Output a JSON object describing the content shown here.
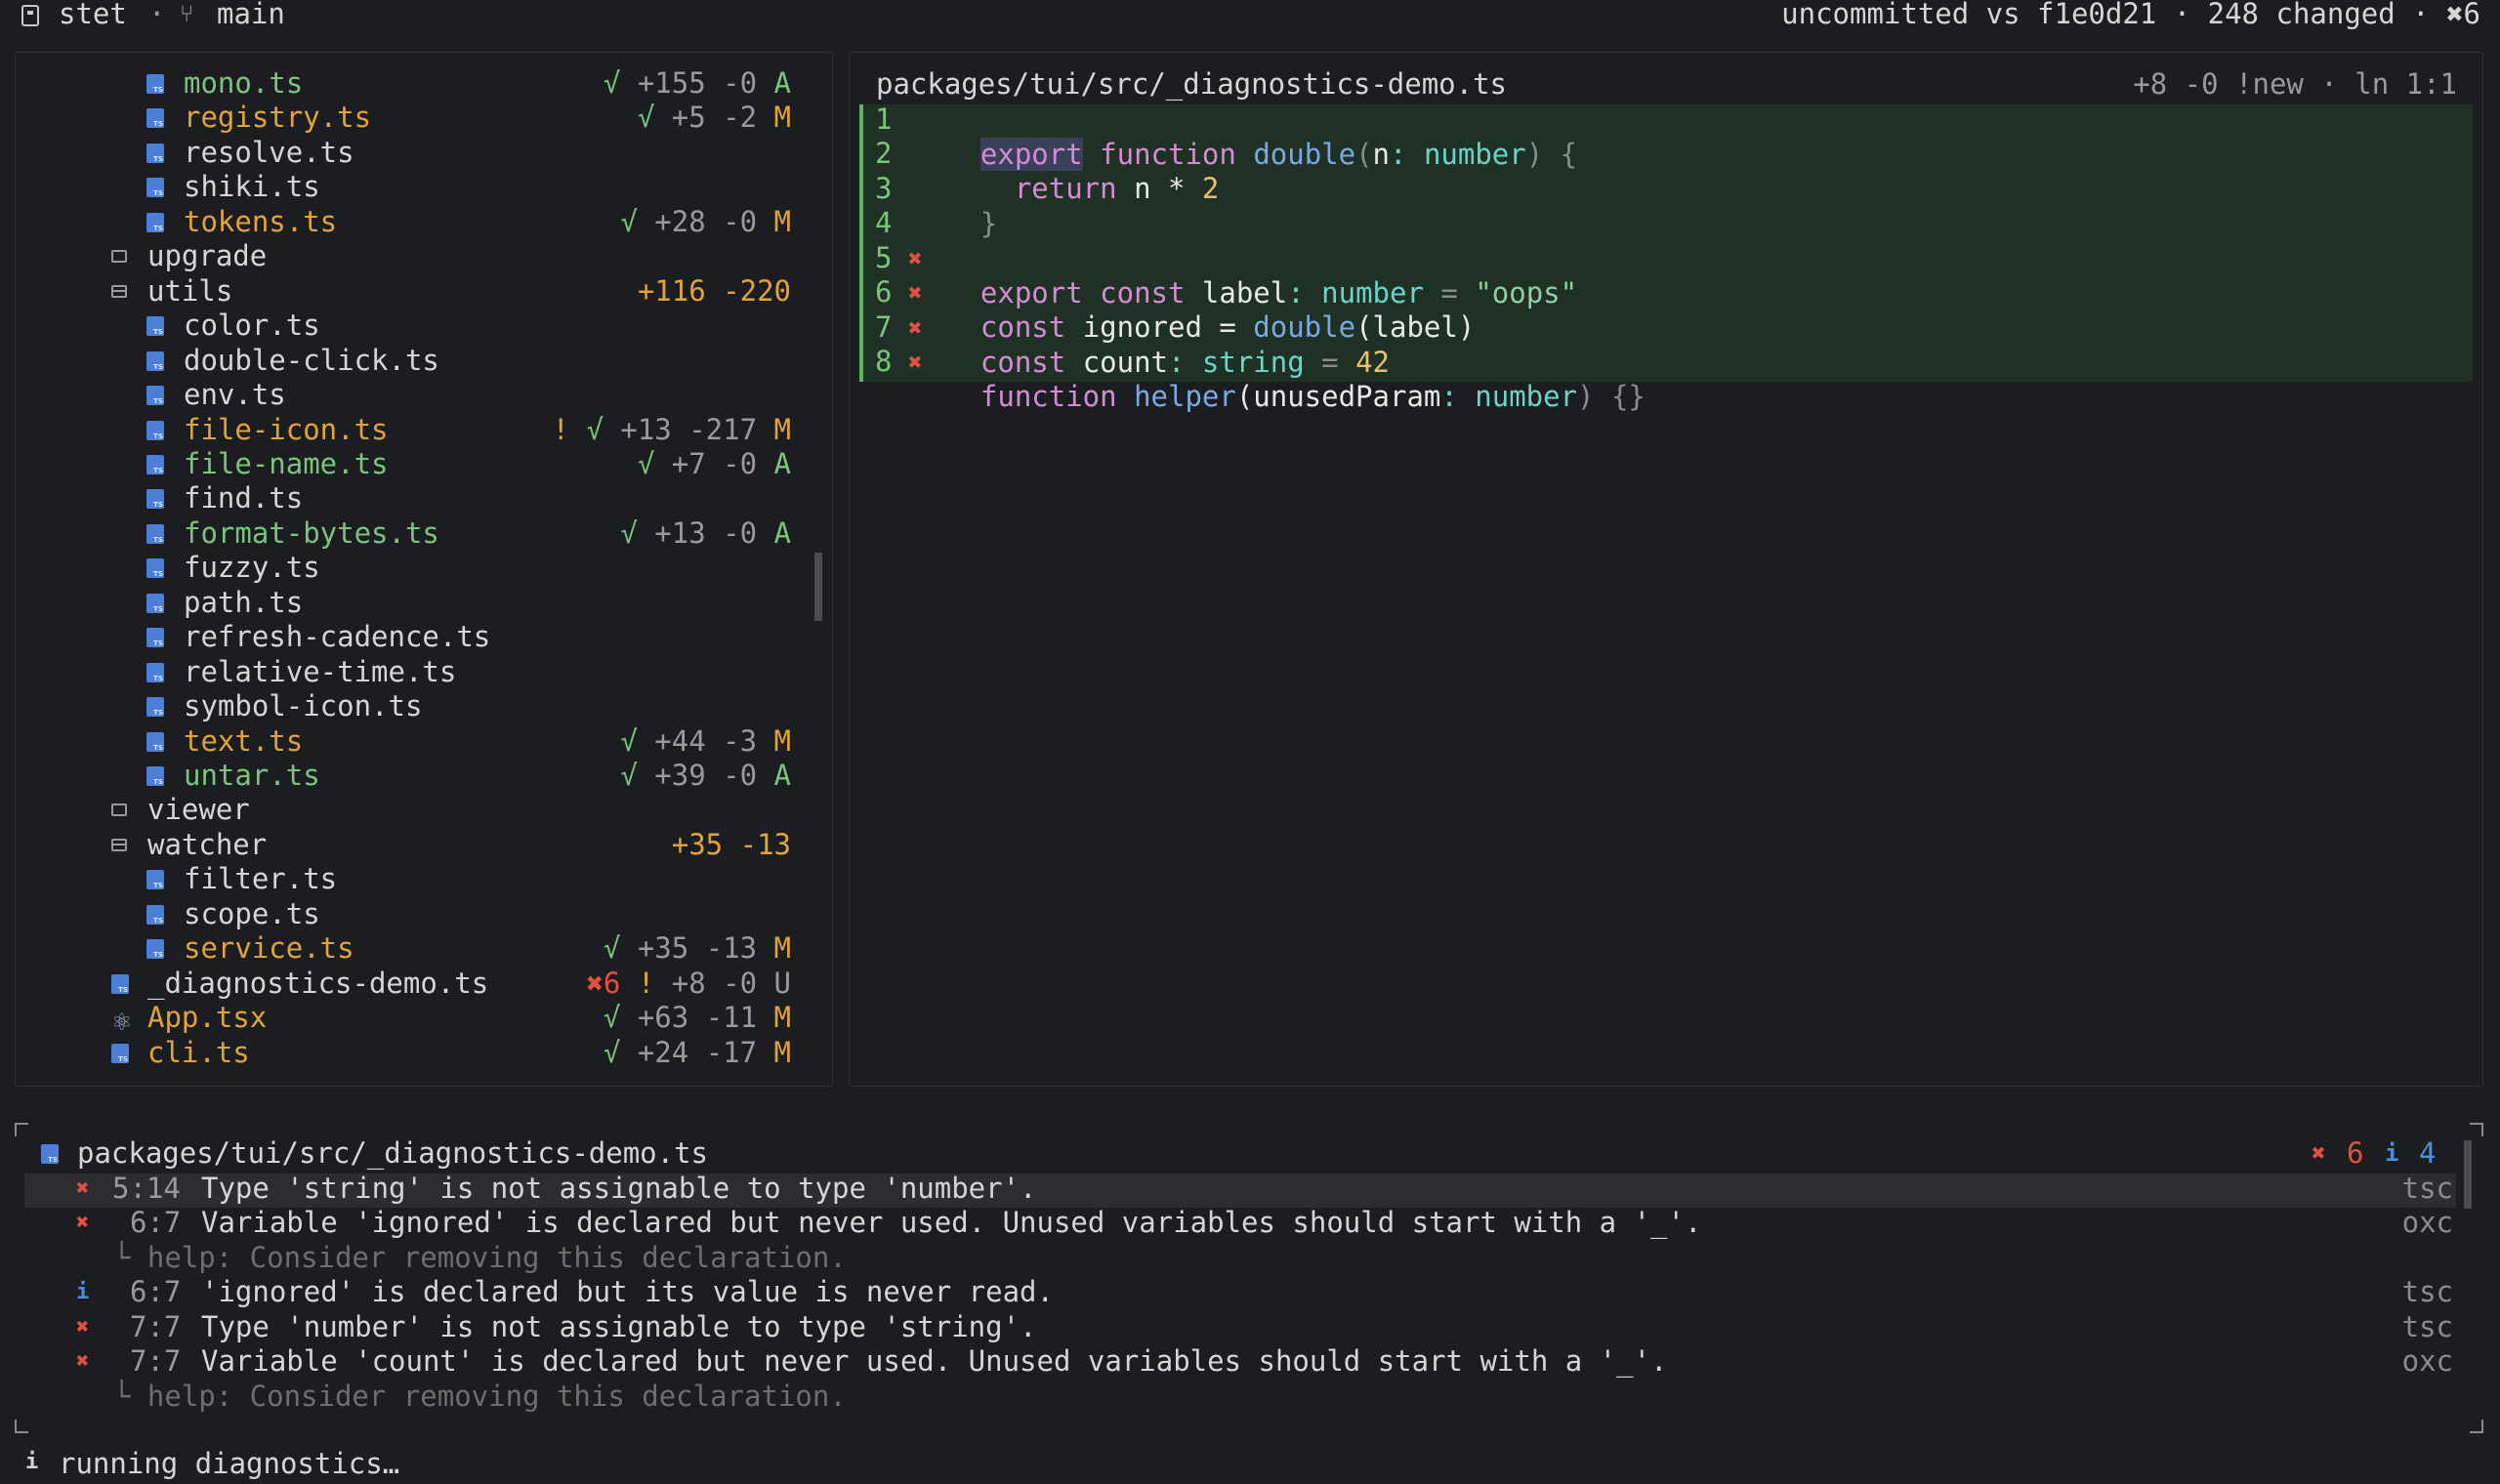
{
  "header": {
    "app": "stet",
    "sep": "·",
    "branch": "main",
    "status": "uncommitted vs f1e0d21 · 248 changed · ✖6"
  },
  "tree": [
    {
      "name": "mono.ts",
      "indent": 2,
      "kind": "ts",
      "state": "A",
      "stats": "√ +155 -0 A"
    },
    {
      "name": "registry.ts",
      "indent": 2,
      "kind": "ts",
      "state": "M",
      "stats": "√ +5 -2 M"
    },
    {
      "name": "resolve.ts",
      "indent": 2,
      "kind": "ts",
      "state": "w",
      "stats": ""
    },
    {
      "name": "shiki.ts",
      "indent": 2,
      "kind": "ts",
      "state": "w",
      "stats": ""
    },
    {
      "name": "tokens.ts",
      "indent": 2,
      "kind": "ts",
      "state": "M",
      "stats": "√ +28 -0 M"
    },
    {
      "name": "upgrade",
      "indent": 1,
      "kind": "folder",
      "state": "w",
      "stats": ""
    },
    {
      "name": "utils",
      "indent": 1,
      "kind": "folder-open",
      "state": "w",
      "stats": "+116 -220"
    },
    {
      "name": "color.ts",
      "indent": 2,
      "kind": "ts",
      "state": "w",
      "stats": ""
    },
    {
      "name": "double-click.ts",
      "indent": 2,
      "kind": "ts",
      "state": "w",
      "stats": ""
    },
    {
      "name": "env.ts",
      "indent": 2,
      "kind": "ts",
      "state": "w",
      "stats": ""
    },
    {
      "name": "file-icon.ts",
      "indent": 2,
      "kind": "ts",
      "state": "M",
      "stats": "! √ +13 -217 M"
    },
    {
      "name": "file-name.ts",
      "indent": 2,
      "kind": "ts",
      "state": "A",
      "stats": "√ +7 -0 A"
    },
    {
      "name": "find.ts",
      "indent": 2,
      "kind": "ts",
      "state": "w",
      "stats": ""
    },
    {
      "name": "format-bytes.ts",
      "indent": 2,
      "kind": "ts",
      "state": "A",
      "stats": "√ +13 -0 A"
    },
    {
      "name": "fuzzy.ts",
      "indent": 2,
      "kind": "ts",
      "state": "w",
      "stats": ""
    },
    {
      "name": "path.ts",
      "indent": 2,
      "kind": "ts",
      "state": "w",
      "stats": ""
    },
    {
      "name": "refresh-cadence.ts",
      "indent": 2,
      "kind": "ts",
      "state": "w",
      "stats": ""
    },
    {
      "name": "relative-time.ts",
      "indent": 2,
      "kind": "ts",
      "state": "w",
      "stats": ""
    },
    {
      "name": "symbol-icon.ts",
      "indent": 2,
      "kind": "ts",
      "state": "w",
      "stats": ""
    },
    {
      "name": "text.ts",
      "indent": 2,
      "kind": "ts",
      "state": "M",
      "stats": "√ +44 -3 M"
    },
    {
      "name": "untar.ts",
      "indent": 2,
      "kind": "ts",
      "state": "A",
      "stats": "√ +39 -0 A"
    },
    {
      "name": "viewer",
      "indent": 1,
      "kind": "folder",
      "state": "w",
      "stats": ""
    },
    {
      "name": "watcher",
      "indent": 1,
      "kind": "folder-open",
      "state": "w",
      "stats": "+35 -13"
    },
    {
      "name": "filter.ts",
      "indent": 2,
      "kind": "ts",
      "state": "w",
      "stats": ""
    },
    {
      "name": "scope.ts",
      "indent": 2,
      "kind": "ts",
      "state": "w",
      "stats": ""
    },
    {
      "name": "service.ts",
      "indent": 2,
      "kind": "ts",
      "state": "M",
      "stats": "√ +35 -13 M"
    },
    {
      "name": "_diagnostics-demo.ts",
      "indent": 1,
      "kind": "ts",
      "state": "w",
      "stats": "✖6 ! +8 -0 U"
    },
    {
      "name": "App.tsx",
      "indent": 1,
      "kind": "react",
      "state": "M",
      "stats": "√ +63 -11 M"
    },
    {
      "name": "cli.ts",
      "indent": 1,
      "kind": "ts",
      "state": "M",
      "stats": "√ +24 -17 M"
    }
  ],
  "editor": {
    "path": "packages/tui/src/_diagnostics-demo.ts",
    "meta": "+8 -0 !new · ln 1:1",
    "lines": [
      {
        "n": "1",
        "mark": ""
      },
      {
        "n": "2",
        "mark": ""
      },
      {
        "n": "3",
        "mark": ""
      },
      {
        "n": "4",
        "mark": ""
      },
      {
        "n": "5",
        "mark": "✖"
      },
      {
        "n": "6",
        "mark": "✖"
      },
      {
        "n": "7",
        "mark": "✖"
      },
      {
        "n": "8",
        "mark": "✖"
      }
    ],
    "tokens": {
      "l1": [
        "export",
        " ",
        "function",
        " ",
        "double",
        "(",
        "n",
        ": ",
        "number",
        ") {"
      ],
      "l2": [
        "  ",
        "return",
        " n * ",
        "2"
      ],
      "l3": [
        "}"
      ],
      "l5": [
        "export",
        " ",
        "const",
        " label",
        ": ",
        "number",
        " = ",
        "\"oops\""
      ],
      "l6": [
        "const",
        " ignored = ",
        "double",
        "(label)"
      ],
      "l7": [
        "const",
        " count",
        ": ",
        "string",
        " = ",
        "42"
      ],
      "l8": [
        "function",
        " ",
        "helper",
        "(unusedParam",
        ": ",
        "number",
        ") {}"
      ]
    }
  },
  "diagnostics": {
    "path": "packages/tui/src/_diagnostics-demo.ts",
    "errors_icon": "✖",
    "errors_count": "6",
    "info_icon": "i",
    "info_count": "4",
    "items": [
      {
        "icon": "✖",
        "kind": "error",
        "loc": "5:14",
        "msg": "Type 'string' is not assignable to type 'number'.",
        "src": "tsc"
      },
      {
        "icon": "✖",
        "kind": "error",
        "loc": "6:7",
        "msg": "Variable 'ignored' is declared but never used. Unused variables should start with a '_'.",
        "src": "oxc"
      },
      {
        "help": "└ help: Consider removing this declaration."
      },
      {
        "icon": "i",
        "kind": "info",
        "loc": "6:7",
        "msg": "'ignored' is declared but its value is never read.",
        "src": "tsc"
      },
      {
        "icon": "✖",
        "kind": "error",
        "loc": "7:7",
        "msg": "Type 'number' is not assignable to type 'string'.",
        "src": "tsc"
      },
      {
        "icon": "✖",
        "kind": "error",
        "loc": "7:7",
        "msg": "Variable 'count' is declared but never used. Unused variables should start with a '_'.",
        "src": "oxc"
      },
      {
        "help": "└ help: Consider removing this declaration."
      }
    ]
  },
  "statusbar": {
    "icon": "i",
    "text": "running diagnostics…"
  }
}
